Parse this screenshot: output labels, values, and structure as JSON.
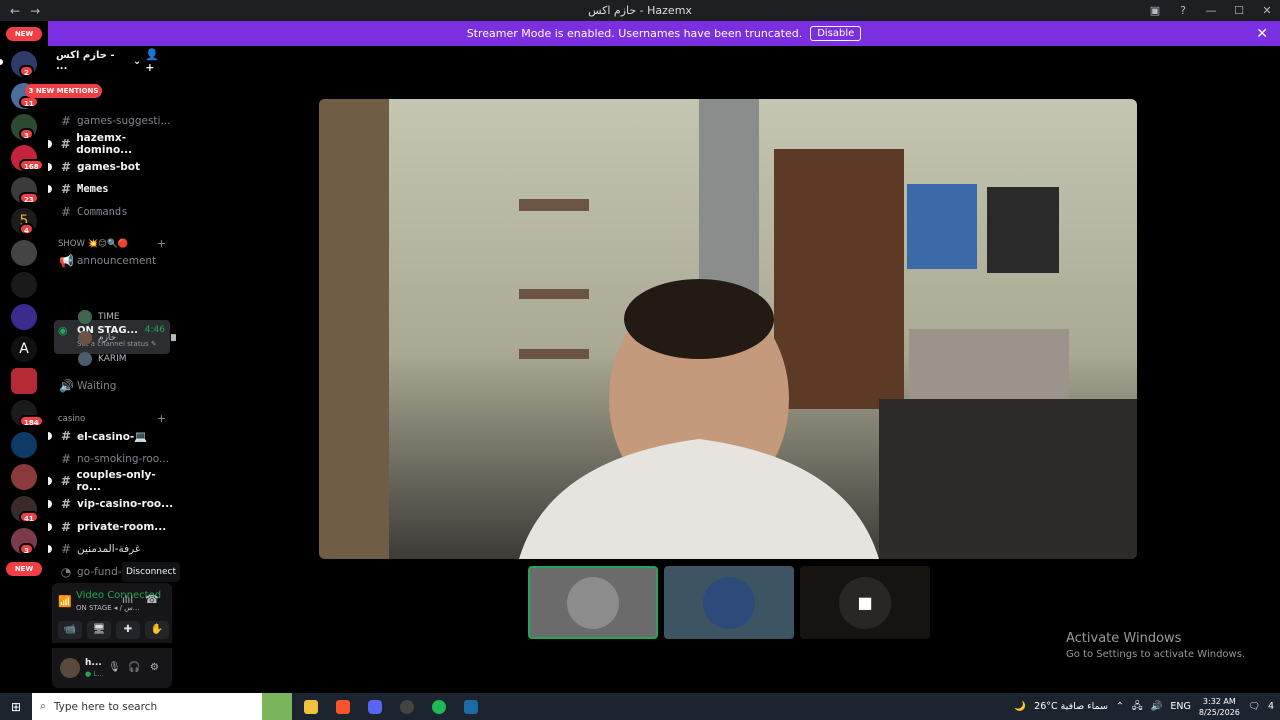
{
  "window": {
    "title": "حازم اكس - Hazemx",
    "nav_back": "←",
    "nav_forward": "→",
    "inbox_icon": "▣",
    "help_icon": "?",
    "minimize": "—",
    "maximize": "☐",
    "close": "✕"
  },
  "banner": {
    "text": "Streamer Mode is enabled. Usernames have been truncated.",
    "button": "Disable",
    "close": "✕"
  },
  "guilds": {
    "new_top": "NEW",
    "new_bottom": "NEW",
    "badges": [
      "2",
      "11",
      "3",
      "168",
      "23",
      "4",
      "184",
      "41",
      "3"
    ]
  },
  "server": {
    "name": "حازم اكس - ...",
    "chevron": "⌄",
    "invite_icon": "👤+"
  },
  "mentions_pill": "3 NEW MENTIONS",
  "channels": [
    {
      "name": "games-suggesti...",
      "bold": false,
      "unread": false,
      "mono": false
    },
    {
      "name": "hazemx-domino...",
      "bold": true,
      "unread": true,
      "mono": false
    },
    {
      "name": "games-bot",
      "bold": true,
      "unread": true,
      "mono": false
    },
    {
      "name": "Memes",
      "bold": true,
      "unread": true,
      "mono": true
    },
    {
      "name": "Commands",
      "bold": false,
      "unread": false,
      "mono": true
    }
  ],
  "category_show": "SHOW 💥😊🔍🔴",
  "category_casino": "casino",
  "announcement": "announcement",
  "stage": {
    "name": "ON STAG...",
    "time": "4:46",
    "status": "Set a channel status ✎"
  },
  "members": [
    {
      "name": "TIME"
    },
    {
      "name": "حازم"
    },
    {
      "name": "KARIM"
    }
  ],
  "waiting": "Waiting",
  "casino_channels": [
    {
      "name": "el-casino-💻",
      "bold": true,
      "unread": true
    },
    {
      "name": "no-smoking-roo...",
      "bold": false,
      "unread": false
    },
    {
      "name": "couples-only-ro...",
      "bold": true,
      "unread": true
    },
    {
      "name": "vip-casino-roo...",
      "bold": true,
      "unread": true
    },
    {
      "name": "private-room...",
      "bold": true,
      "unread": true
    },
    {
      "name": "غرفة-المدمنين",
      "bold": false,
      "unread": true
    },
    {
      "name": "go-fund-",
      "bold": false,
      "unread": false
    }
  ],
  "tooltip": "Disconnect",
  "voice": {
    "status": "Video Connected",
    "sub": "ON STAGE ◂ / س...",
    "signal_icon": "📶",
    "wave_icon": "ılıl",
    "hangup_icon": "☎"
  },
  "voice_buttons": [
    "📹",
    "🖥",
    "✚",
    "✋"
  ],
  "user": {
    "name": "h...",
    "status": "● L...",
    "mic_icon": "🎙",
    "headset_icon": "🎧",
    "settings_icon": "⚙"
  },
  "activate": {
    "line1": "Activate Windows",
    "line2": "Go to Settings to activate Windows."
  },
  "taskbar": {
    "start_icon": "⊞",
    "search_icon": "⌕",
    "search_placeholder": "Type here to search",
    "weather": "26°C  سماء صافية",
    "weather_icon": "🌙",
    "lang": "ENG",
    "time": "3:32 AM",
    "date": "8/25/2026",
    "notif_count": "4"
  },
  "colors": {
    "banner": "#7b2fe0",
    "accent_green": "#23a55a",
    "mention_red": "#f23f43"
  }
}
